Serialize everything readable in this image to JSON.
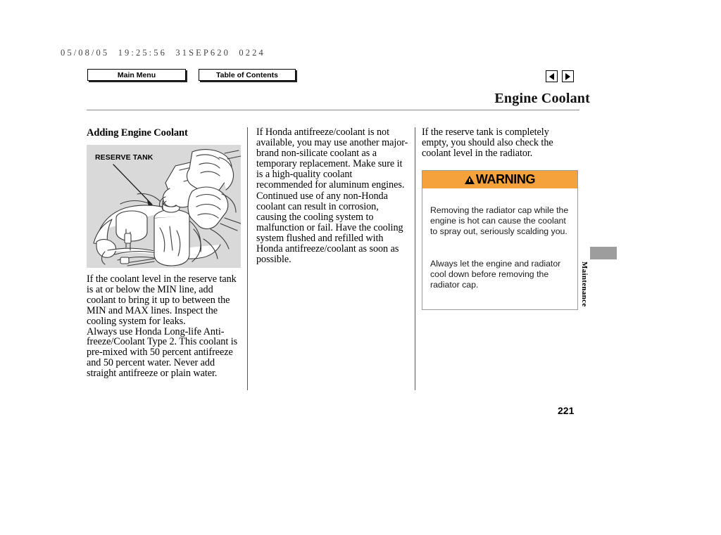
{
  "header": {
    "timestamp": "05/08/05  19:25:56  31SEP620  0224",
    "main_menu_label": "Main Menu",
    "table_of_contents_label": "Table of Contents",
    "prev_arrow_icon": "triangle-left-icon",
    "next_arrow_icon": "triangle-right-icon"
  },
  "page": {
    "title": "Engine Coolant",
    "number": "221",
    "side_tab_label": "Maintenance"
  },
  "columns": {
    "left": {
      "heading": "Adding Engine Coolant",
      "illustration_label": "RESERVE TANK",
      "illustration_alt": "Hands pouring coolant from a bottle into the engine coolant reserve tank",
      "body": "If the coolant level in the reserve tank is at or below the MIN line, add coolant to bring it up to between the MIN and MAX lines. Inspect the cooling system for leaks.\nAlways use Honda Long-life Anti-freeze/Coolant Type 2. This coolant is pre-mixed with 50 percent antifreeze and 50 percent water. Never add straight antifreeze or plain water."
    },
    "middle": {
      "body": "If Honda antifreeze/coolant is not available, you may use another major-brand non-silicate coolant as a temporary replacement. Make sure it is a high-quality coolant recommended for aluminum engines. Continued use of any non-Honda coolant can result in corrosion, causing the cooling system to malfunction or fail. Have the cooling system flushed and refilled with Honda antifreeze/coolant as soon as possible."
    },
    "right": {
      "intro": "If the reserve tank is completely empty, you should also check the coolant level in the radiator.",
      "warning": {
        "icon": "warning-triangle-icon",
        "title": "WARNING",
        "paragraph1": "Removing the radiator cap while the engine is hot can cause the coolant to spray out, seriously scalding you.",
        "paragraph2": "Always let the engine and radiator cool down before removing the radiator cap."
      }
    }
  },
  "colors": {
    "warning_header_bg": "#f5a23c",
    "illustration_bg": "#d9d9d9",
    "side_tab_block": "#9d9d9d",
    "rule": "#8a8a8a"
  }
}
